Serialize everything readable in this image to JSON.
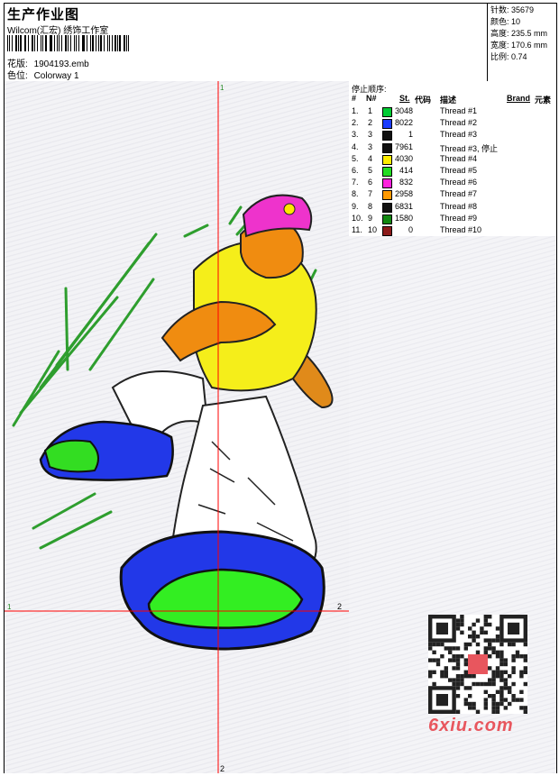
{
  "header": {
    "title": "生产作业图",
    "company": "Wilcom(汇宏) 绣饰工作室",
    "design_file_label": "花版:",
    "design_file": "1904193.emb",
    "colorway_label": "色位:",
    "colorway": "Colorway 1"
  },
  "stats": [
    {
      "label": "针数:",
      "value": "35679"
    },
    {
      "label": "颜色:",
      "value": "10"
    },
    {
      "label": "高度:",
      "value": "235.5 mm"
    },
    {
      "label": "宽度:",
      "value": "170.6 mm"
    },
    {
      "label": "比例:",
      "value": "0.74"
    }
  ],
  "axis_labels": {
    "top": "1",
    "left": "1",
    "right": "2",
    "bottom": "2"
  },
  "sequence": {
    "title": "停止顺序:",
    "headers": {
      "num": "#",
      "n": "N#",
      "st": "St.",
      "code": "代码",
      "desc": "描述",
      "brand": "Brand",
      "elem": "元素"
    },
    "rows": [
      {
        "num": "1.",
        "n": "1",
        "color": "#00cc33",
        "code": "3048",
        "desc": "Thread #1"
      },
      {
        "num": "2.",
        "n": "2",
        "color": "#1a3cff",
        "code": "8022",
        "desc": "Thread #2"
      },
      {
        "num": "3.",
        "n": "3",
        "color": "#111111",
        "code": "1",
        "desc": "Thread #3"
      },
      {
        "num": "4.",
        "n": "3",
        "color": "#111111",
        "code": "7961",
        "desc": "Thread  #3, 停止"
      },
      {
        "num": "5.",
        "n": "4",
        "color": "#ffee00",
        "code": "4030",
        "desc": "Thread #4"
      },
      {
        "num": "6.",
        "n": "5",
        "color": "#22dd22",
        "code": "414",
        "desc": "Thread #5"
      },
      {
        "num": "7.",
        "n": "6",
        "color": "#ff22dd",
        "code": "832",
        "desc": "Thread #6"
      },
      {
        "num": "8.",
        "n": "7",
        "color": "#ff9900",
        "code": "2958",
        "desc": "Thread #7"
      },
      {
        "num": "9.",
        "n": "8",
        "color": "#111111",
        "code": "6831",
        "desc": "Thread #8"
      },
      {
        "num": "10.",
        "n": "9",
        "color": "#118811",
        "code": "1580",
        "desc": "Thread #9"
      },
      {
        "num": "11.",
        "n": "10",
        "color": "#8b1a1a",
        "code": "0",
        "desc": "Thread #10"
      }
    ]
  },
  "watermark": "6xiu.com"
}
